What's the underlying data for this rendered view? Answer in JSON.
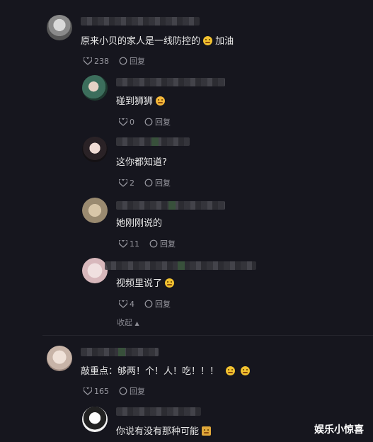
{
  "comments": [
    {
      "text": "原来小贝的家人是一线防控的",
      "emoji": "face",
      "suffix": "加油",
      "likes": "238",
      "reply_label": "回复"
    },
    {
      "text": "碰到狮狮",
      "emoji": "laugh",
      "suffix": "",
      "likes": "0",
      "reply_label": "回复"
    },
    {
      "text": "这你都知道?",
      "emoji": "",
      "suffix": "",
      "likes": "2",
      "reply_label": "回复"
    },
    {
      "text": "她刚刚说的",
      "emoji": "",
      "suffix": "",
      "likes": "11",
      "reply_label": "回复"
    },
    {
      "text": "视频里说了",
      "emoji": "face",
      "suffix": "",
      "likes": "4",
      "reply_label": "回复"
    },
    {
      "text": "敲重点：够两！个！人！吃！！！",
      "emoji": "face2",
      "suffix": "",
      "likes": "165",
      "reply_label": "回复"
    },
    {
      "text": "你说有没有那种可能",
      "emoji": "note",
      "suffix": "",
      "likes": "",
      "reply_label": ""
    }
  ],
  "collapse_label": "收起",
  "watermark": "娱乐小惊喜",
  "icons": {
    "like": "heart-icon",
    "reply": "reply-bubble-icon",
    "collapse": "chevron-up-icon"
  },
  "colors": {
    "background": "#16161e",
    "text": "#e8e8e8",
    "meta": "#9a9aa2"
  }
}
